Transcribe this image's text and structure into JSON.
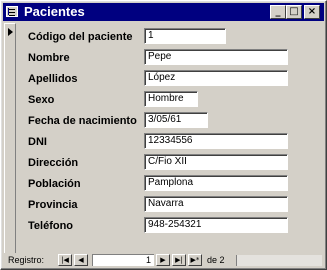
{
  "window": {
    "title": "Pacientes"
  },
  "titlebar_buttons": {
    "minimize": "_",
    "maximize": "□",
    "close": "×"
  },
  "fields": [
    {
      "label": "Código del paciente",
      "value": "1"
    },
    {
      "label": "Nombre",
      "value": "Pepe"
    },
    {
      "label": "Apellidos",
      "value": "López"
    },
    {
      "label": "Sexo",
      "value": "Hombre"
    },
    {
      "label": "Fecha de nacimiento",
      "value": "3/05/61"
    },
    {
      "label": "DNI",
      "value": "12334556"
    },
    {
      "label": "Dirección",
      "value": "C/Fio XII"
    },
    {
      "label": "Población",
      "value": "Pamplona"
    },
    {
      "label": "Provincia",
      "value": "Navarra"
    },
    {
      "label": "Teléfono",
      "value": "948-254321"
    }
  ],
  "navigation": {
    "label": "Registro:",
    "first": "|◀",
    "previous": "◀",
    "current_record": "1",
    "next": "▶",
    "last": "▶|",
    "new_record": "▶*",
    "of_text": "de 2"
  }
}
